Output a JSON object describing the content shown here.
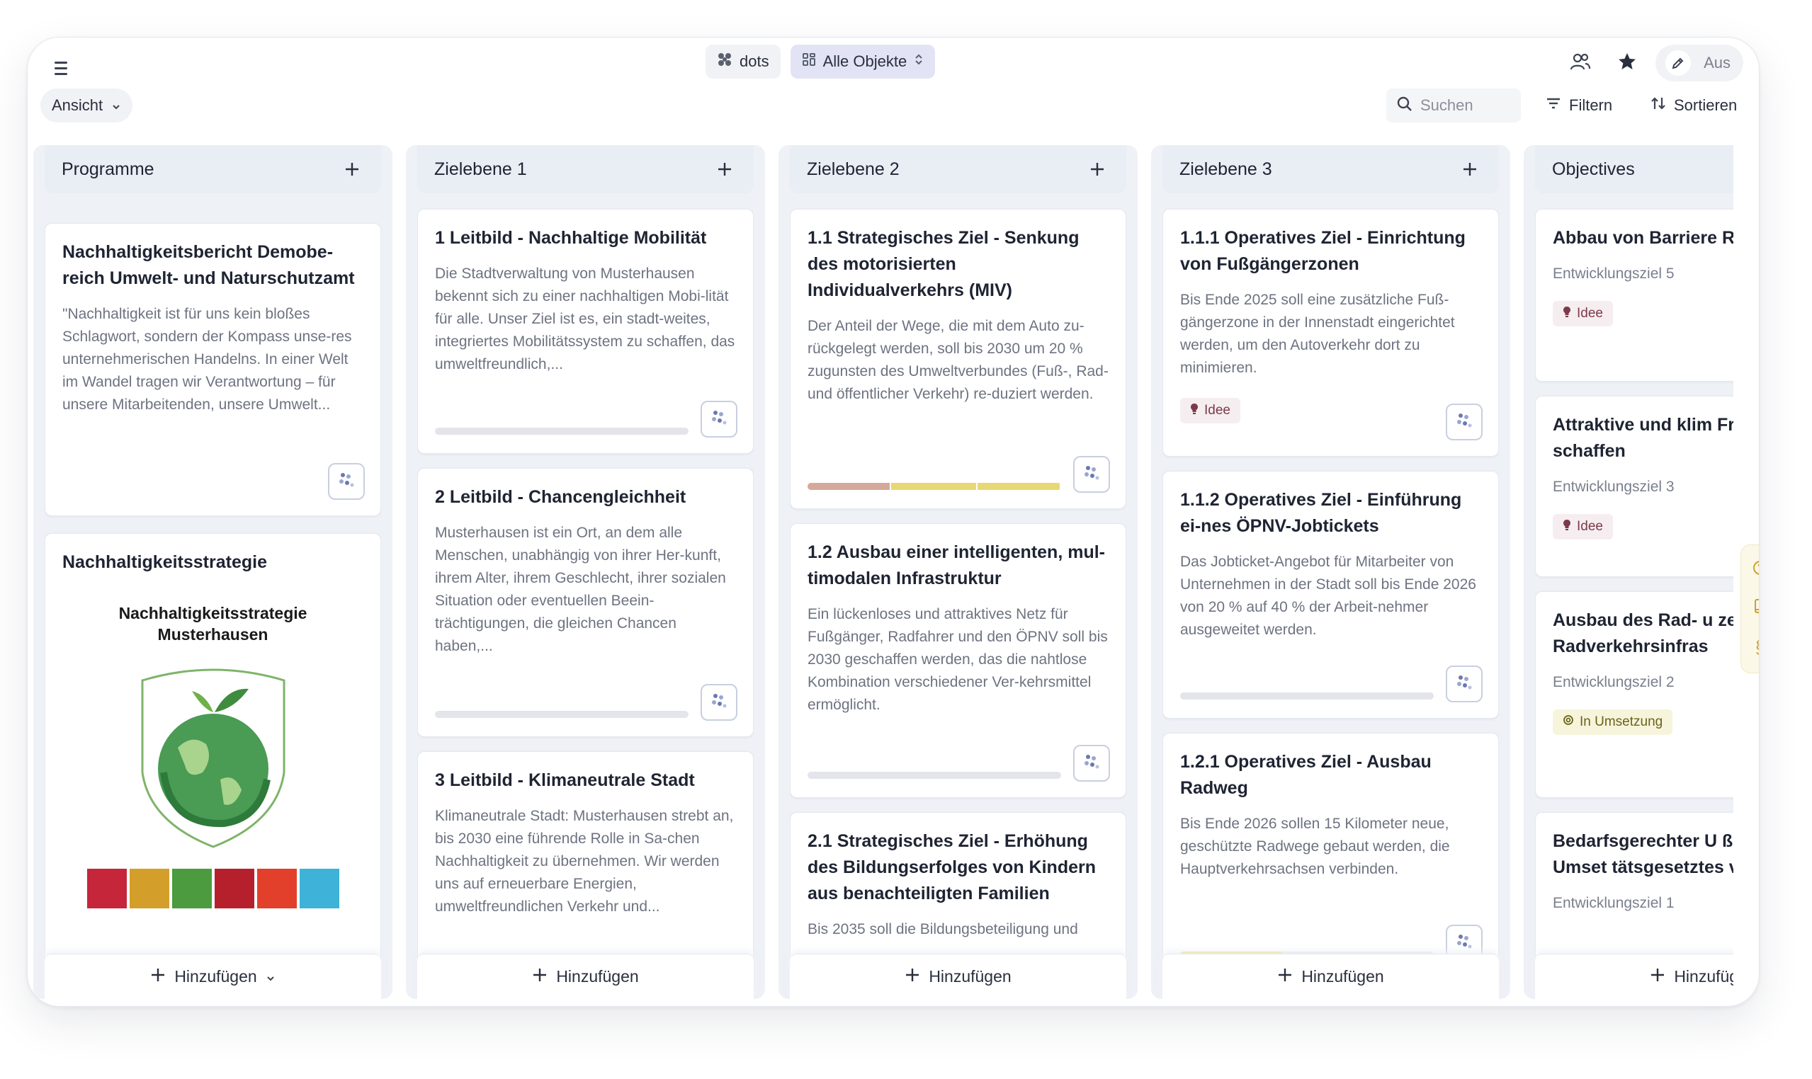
{
  "toolbar": {
    "workspace_label": "dots",
    "view_selector_label": "Alle Objekte",
    "mode_toggle_label": "Aus",
    "view_menu_label": "Ansicht",
    "search_placeholder": "Suchen",
    "filter_label": "Filtern",
    "sort_label": "Sortieren"
  },
  "colors": {
    "accent_lavender": "#e2e4f5",
    "column_bg": "#eef1f6",
    "progress_rose": "#d5a99a",
    "progress_yellow": "#e8d874",
    "badge_idee": "#7b3a4a",
    "badge_umsetzung": "#6b6218"
  },
  "columns": [
    {
      "title": "Programme",
      "add_label": "Hinzufügen",
      "cards": [
        {
          "title": "Nachhaltigkeitsbericht Demobe-reich Umwelt- und Naturschutzamt",
          "text": "\"Nachhaltigkeit ist für uns kein bloßes Schlagwort, sondern der Kompass unse-res unternehmerischen Handelns. In einer Welt im Wandel tragen wir Verantwortung – für unsere Mitarbeitenden, unsere Umwelt..."
        },
        {
          "title": "Nachhaltigkeitsstrategie",
          "image_title_line1": "Nachhaltigkeitsstrategie",
          "image_title_line2": "Musterhausen"
        }
      ]
    },
    {
      "title": "Zielebene 1",
      "add_label": "Hinzufügen",
      "cards": [
        {
          "title": "1 Leitbild - Nachhaltige Mobilität",
          "text": "Die Stadtverwaltung von Musterhausen bekennt sich zu einer nachhaltigen Mobi-lität für alle. Unser Ziel ist es, ein stadt-weites, integriertes Mobilitätssystem zu schaffen, das umweltfreundlich,...",
          "progress": 0
        },
        {
          "title": "2 Leitbild - Chancengleichheit",
          "text": "Musterhausen ist ein Ort, an dem alle Menschen, unabhängig von ihrer Her-kunft, ihrem Alter, ihrem Geschlecht, ihrer sozialen Situation oder eventuellen Beein-trächtigungen, die gleichen Chancen haben,...",
          "progress": 0
        },
        {
          "title": "3 Leitbild - Klimaneutrale Stadt",
          "text": "Klimaneutrale Stadt: Musterhausen strebt an, bis 2030 eine führende Rolle in Sa-chen Nachhaltigkeit zu übernehmen. Wir werden uns auf erneuerbare Energien, umweltfreundlichen Verkehr und..."
        }
      ]
    },
    {
      "title": "Zielebene 2",
      "add_label": "Hinzufügen",
      "cards": [
        {
          "title": "1.1 Strategisches Ziel - Senkung des motorisierten Individualverkehrs (MIV)",
          "text": "Der Anteil der Wege, die mit dem Auto zu-rückgelegt werden, soll bis 2030 um 20 % zugunsten des Umweltverbundes (Fuß-, Rad- und öffentlicher Verkehr) re-duziert werden.",
          "progress_segments": [
            {
              "fraction": 0.33,
              "color": "#d5a99a"
            },
            {
              "fraction": 0.34,
              "color": "#e8d874"
            },
            {
              "fraction": 0.33,
              "color": "#e8d874"
            }
          ]
        },
        {
          "title": "1.2 Ausbau einer intelligenten, mul-timodalen Infrastruktur",
          "text": "Ein lückenloses und attraktives Netz für Fußgänger, Radfahrer und den ÖPNV soll bis 2030 geschaffen werden, das die nahtlose Kombination verschiedener Ver-kehrsmittel ermöglicht.",
          "progress": 0
        },
        {
          "title": "2.1 Strategisches Ziel - Erhöhung des Bildungserfolges von Kindern aus benachteiligten Familien",
          "text": "Bis 2035 soll die Bildungsbeteiligung und"
        }
      ]
    },
    {
      "title": "Zielebene 3",
      "add_label": "Hinzufügen",
      "cards": [
        {
          "title": "1.1.1 Operatives Ziel - Einrichtung von Fußgängerzonen",
          "text": "Bis Ende 2025 soll eine zusätzliche Fuß-gängerzone in der Innenstadt eingerichtet werden, um den Autoverkehr dort zu minimieren.",
          "badge": "Idee"
        },
        {
          "title": "1.1.2 Operatives Ziel - Einführung ei-nes ÖPNV-Jobtickets",
          "text": "Das Jobticket-Angebot für Mitarbeiter von Unternehmen in der Stadt soll bis Ende 2026 von 20 % auf 40 % der Arbeit-nehmer ausgeweitet werden.",
          "progress": 0
        },
        {
          "title": "1.2.1 Operatives Ziel - Ausbau Radweg",
          "text": "Bis Ende 2026 sollen 15 Kilometer neue, geschützte Radwege gebaut werden, die Hauptverkehrsachsen verbinden.",
          "progress": 0.4
        }
      ]
    },
    {
      "title": "Objectives",
      "add_label": "Hinzufügen",
      "cards": [
        {
          "title": "Abbau von Barriere Raum",
          "sub": "Entwicklungsziel 5",
          "badge": "Idee"
        },
        {
          "title": "Attraktive und klim Freiräume schaffen",
          "sub": "Entwicklungsziel 3",
          "badge": "Idee"
        },
        {
          "title": "Ausbau des Rad- u zes sowie der Radverkehrsinfras",
          "sub": "Entwicklungsziel 2",
          "badge": "In Umsetzung"
        },
        {
          "title": "Bedarfsgerechter U ßenraums - Umset tätsgesetztes von",
          "sub": "Entwicklungsziel 1"
        }
      ]
    }
  ],
  "float_toolbar": {
    "help_icon": "question-circle-icon",
    "book_icon": "book-icon",
    "paragraph_icon": "paragraph-icon",
    "paragraph_glyph": "§"
  }
}
